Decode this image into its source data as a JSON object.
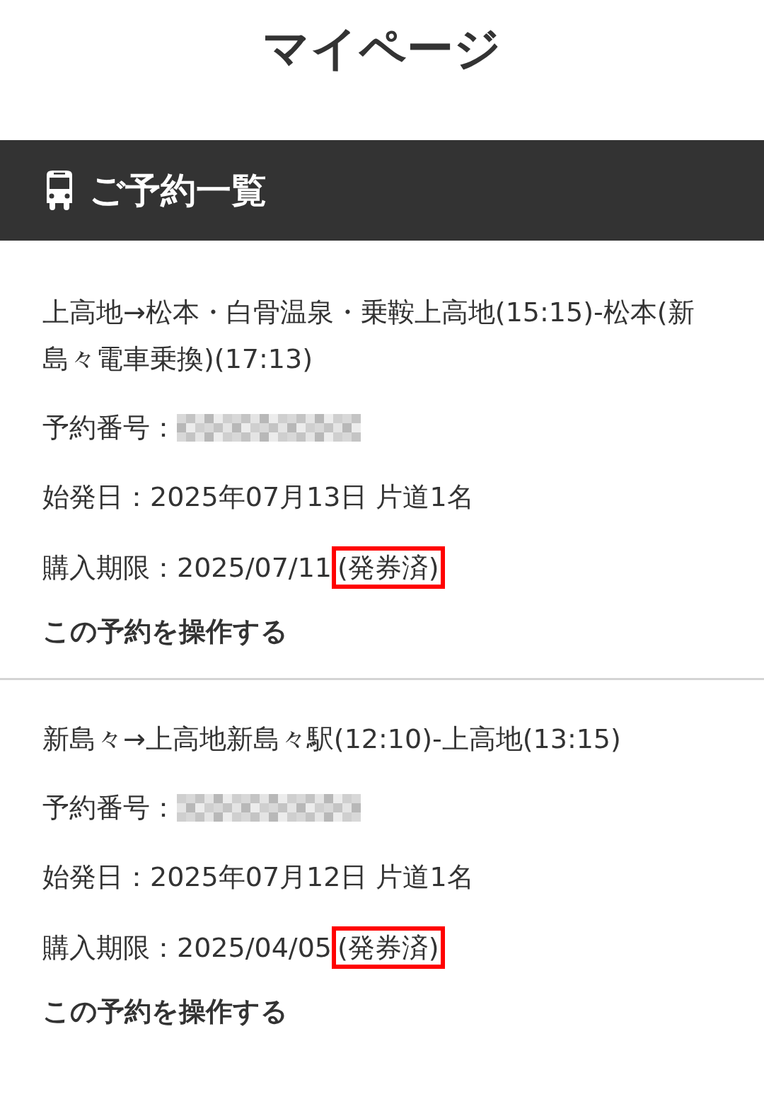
{
  "page_title": "マイページ",
  "section": {
    "title": "ご予約一覧"
  },
  "reservations": [
    {
      "route": "上高地→松本・白骨温泉・乗鞍上高地(15:15)-松本(新島々電車乗換)(17:13)",
      "number_label": "予約番号：",
      "number_redacted": true,
      "departure": "始発日：2025年07月13日 片道1名",
      "deadline": "購入期限：2025/07/11",
      "status": "(発券済)",
      "status_highlighted": true,
      "action": "この予約を操作する"
    },
    {
      "route": "新島々→上高地新島々駅(12:10)-上高地(13:15)",
      "number_label": "予約番号：",
      "number_redacted": true,
      "departure": "始発日：2025年07月12日 片道1名",
      "deadline": "購入期限：2025/04/05",
      "status": "(発券済)",
      "status_highlighted": true,
      "action": "この予約を操作する"
    }
  ]
}
